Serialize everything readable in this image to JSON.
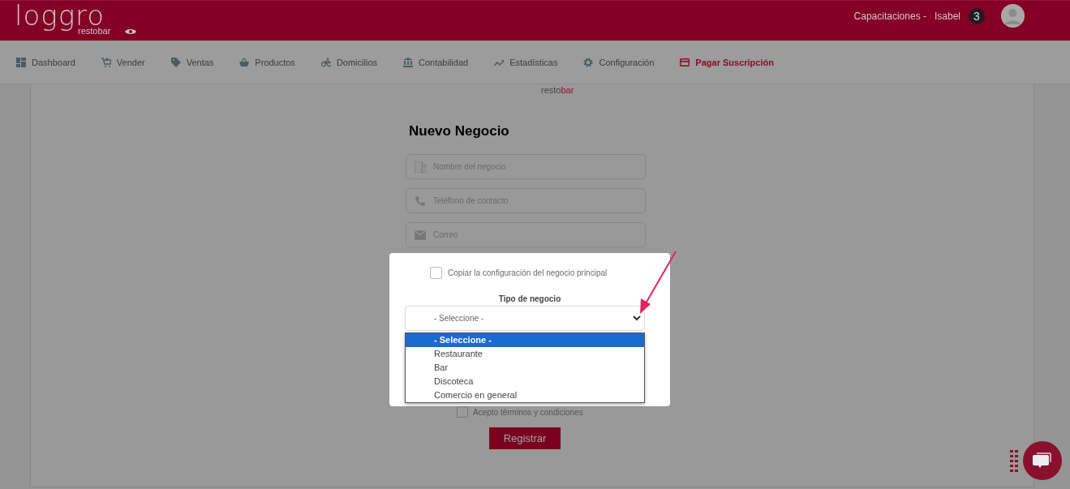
{
  "header": {
    "logo_word": "loggro",
    "logo_sub": "restobar",
    "company": "Capacitaciones -",
    "user": "Isabel",
    "notifications": "3"
  },
  "nav": [
    {
      "label": "Dashboard",
      "highlighted": false
    },
    {
      "label": "Vender",
      "highlighted": false
    },
    {
      "label": "Ventas",
      "highlighted": false
    },
    {
      "label": "Productos",
      "highlighted": false
    },
    {
      "label": "Domicilios",
      "highlighted": false
    },
    {
      "label": "Contabilidad",
      "highlighted": false
    },
    {
      "label": "Estadísticas",
      "highlighted": false
    },
    {
      "label": "Configuración",
      "highlighted": false
    },
    {
      "label": "Pagar Suscripción",
      "highlighted": true
    }
  ],
  "form": {
    "logo_sub_a": "resto",
    "logo_sub_b": "bar",
    "title": "Nuevo Negocio",
    "fields": [
      {
        "placeholder": "Nombre del negocio"
      },
      {
        "placeholder": "Teléfono de contacto"
      },
      {
        "placeholder": "Correo"
      }
    ],
    "terms": {
      "label": "Acepto términos y condiciones",
      "checked": false
    },
    "submit": "Registrar"
  },
  "spotlight": {
    "copy_config": {
      "label": "Copiar la configuración del negocio principal",
      "checked": false
    },
    "type_label": "Tipo de negocio",
    "type_value": "- Seleccione -",
    "options": [
      {
        "label": "- Seleccione -",
        "selected": true
      },
      {
        "label": "Restaurante",
        "selected": false
      },
      {
        "label": "Bar",
        "selected": false
      },
      {
        "label": "Discoteca",
        "selected": false
      },
      {
        "label": "Comercio en general",
        "selected": false
      }
    ]
  }
}
